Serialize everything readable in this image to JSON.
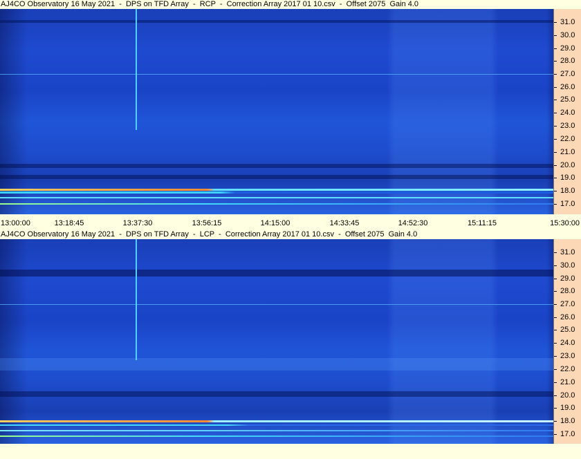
{
  "panels": [
    {
      "title": "AJ4CO Observatory 16 May 2021  -  DPS on TFD Array  -  RCP  -  Correction Array 2017 01 10.csv  -  Offset 2075  Gain 4.0",
      "polarization": "RCP"
    },
    {
      "title": "AJ4CO Observatory 16 May 2021  -  DPS on TFD Array  -  LCP  -  Correction Array 2017 01 10.csv  -  Offset 2075  Gain 4.0",
      "polarization": "LCP"
    }
  ],
  "frequency_axis": {
    "labels": [
      "31.0",
      "30.0",
      "29.0",
      "28.0",
      "27.0",
      "26.0",
      "25.0",
      "24.0",
      "23.0",
      "22.0",
      "21.0",
      "20.0",
      "19.0",
      "18.0",
      "17.0"
    ]
  },
  "time_axis": {
    "labels": [
      "13:00:00",
      "13:18:45",
      "13:37:30",
      "13:56:15",
      "14:15:00",
      "14:33:45",
      "14:52:30",
      "15:11:15",
      "15:30:00"
    ]
  },
  "colors": {
    "background": "#ffffe1",
    "axis_background": "#fdd8b6",
    "spectrogram_base": "#1e4ad0",
    "interference_line": "#4fd0ff",
    "hot_band": "#ffb040"
  }
}
